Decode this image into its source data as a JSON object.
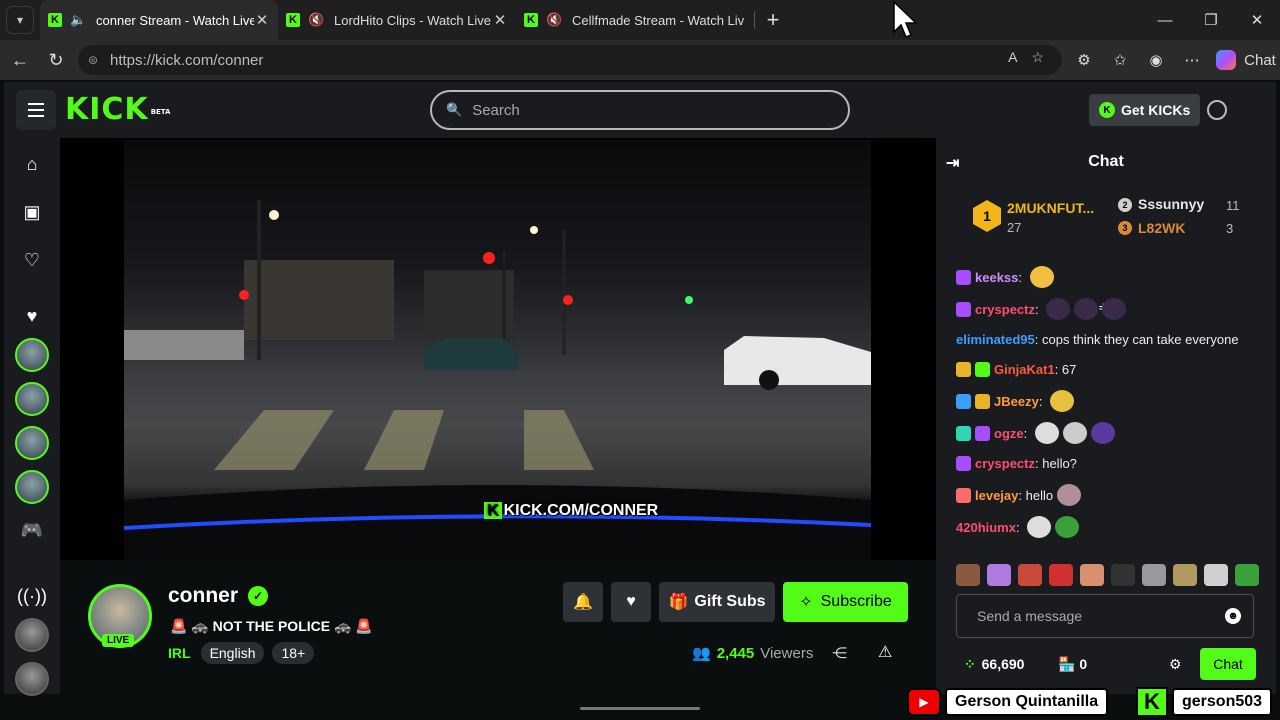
{
  "browser": {
    "tabs": [
      {
        "title": "conner Stream - Watch Live o",
        "active": true
      },
      {
        "title": "LordHito Clips - Watch Live o",
        "active": false
      },
      {
        "title": "Cellfmade Stream - Watch Liv",
        "active": false
      }
    ],
    "url": "https://kick.com/conner",
    "copilot_label": "Chat"
  },
  "kick": {
    "logo": "KICK",
    "logo_badge": "BETA",
    "search_placeholder": "Search",
    "get_kicks_label": "Get KICKs"
  },
  "video": {
    "watermark": "KICK.COM/CONNER"
  },
  "stream": {
    "username": "conner",
    "live_label": "LIVE",
    "title": "🚨 🚓 NOT THE POLICE 🚓 🚨",
    "category": "IRL",
    "tags": [
      "English",
      "18+"
    ],
    "gift_label": "Gift Subs",
    "subscribe_label": "Subscribe",
    "viewers_count": "2,445",
    "viewers_label": "Viewers"
  },
  "chat": {
    "title": "Chat",
    "leaderboard": {
      "first": {
        "rank": "1",
        "name": "2MUKNFUT...",
        "count": "27"
      },
      "second": {
        "rank": "2",
        "name": "Sssunnyy",
        "count": "11"
      },
      "third": {
        "rank": "3",
        "name": "L82WK",
        "count": "3"
      }
    },
    "messages": [
      {
        "user": "keekss",
        "text": "",
        "color": "#cf8bff"
      },
      {
        "user": "cryspectz",
        "text": "",
        "color": "#ff4d6d"
      },
      {
        "user": "eliminated95",
        "text": "cops think they can take everyone",
        "color": "#3aa0ff"
      },
      {
        "user": "GinjaKat1",
        "text": "67",
        "color": "#ff5a3a"
      },
      {
        "user": "JBeezy",
        "text": "",
        "color": "#ff9b3a"
      },
      {
        "user": "ogze",
        "text": "",
        "color": "#ff4d6d"
      },
      {
        "user": "cryspectz",
        "text": "hello?",
        "color": "#ff4d6d"
      },
      {
        "user": "levejay",
        "text": "hello",
        "color": "#ff9b3a"
      },
      {
        "user": "420hiumx",
        "text": "",
        "color": "#ff4d6d"
      }
    ],
    "input_placeholder": "Send a message",
    "kicks_balance": "66,690",
    "shop_count": "0",
    "send_label": "Chat"
  },
  "overlay": {
    "youtube_name": "Gerson Quintanilla",
    "kick_name": "gerson503"
  },
  "colors": {
    "accent": "#53fc18",
    "background": "#0b0e0f",
    "panel": "#191b1f"
  }
}
